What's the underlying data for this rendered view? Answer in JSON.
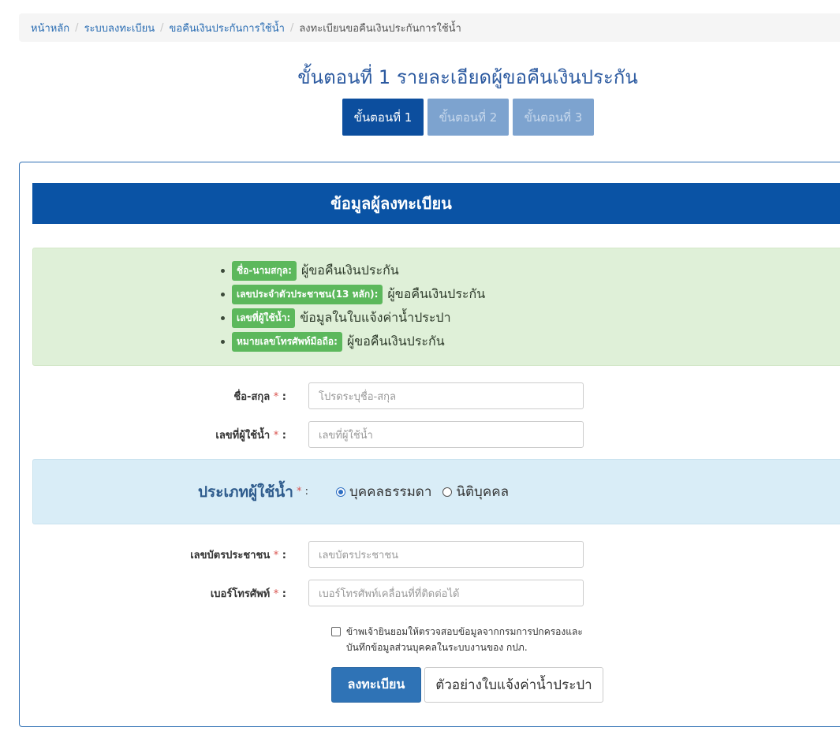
{
  "breadcrumb": {
    "items": [
      "หน้าหลัก",
      "ระบบลงทะเบียน",
      "ขอคืนเงินประกันการใช้น้ำ"
    ],
    "active": "ลงทะเบียนขอคืนเงินประกันการใช้น้ำ",
    "separator": "/"
  },
  "step_title": "ขั้นตอนที่ 1 รายละเอียดผู้ขอคืนเงินประกัน",
  "steps": [
    "ขั้นตอนที่ 1",
    "ขั้นตอนที่ 2",
    "ขั้นตอนที่ 3"
  ],
  "card": {
    "header": "ข้อมูลผู้ลงทะเบียน",
    "info": [
      {
        "badge": "ชื่อ-นามสกุล:",
        "text": "ผู้ขอคืนเงินประกัน"
      },
      {
        "badge": "เลขประจำตัวประชาชน(13 หลัก):",
        "text": "ผู้ขอคืนเงินประกัน"
      },
      {
        "badge": "เลขที่ผู้ใช้น้ำ:",
        "text": "ข้อมูลในใบแจ้งค่าน้ำประปา"
      },
      {
        "badge": "หมายเลขโทรศัพท์มือถือ:",
        "text": "ผู้ขอคืนเงินประกัน"
      }
    ]
  },
  "form": {
    "required_mark": "*",
    "colon": ":",
    "name": {
      "label": "ชื่อ-สกุล",
      "placeholder": "โปรดระบุชื่อ-สกุล"
    },
    "user_no": {
      "label": "เลขที่ผู้ใช้น้ำ",
      "placeholder": "เลขที่ผู้ใช้น้ำ"
    },
    "user_type": {
      "label": "ประเภทผู้ใช้น้ำ",
      "options": [
        "บุคคลธรรมดา",
        "นิติบุคคล"
      ],
      "selected": "บุคคลธรรมดา"
    },
    "id_card": {
      "label": "เลขบัตรประชาชน",
      "placeholder": "เลขบัตรประชาชน"
    },
    "phone": {
      "label": "เบอร์โทรศัพท์",
      "placeholder": "เบอร์โทรศัพท์เคลื่อนที่ที่ติดต่อได้"
    },
    "consent_line1": "ข้าพเจ้ายินยอมให้ตรวจสอบข้อมูลจากกรมการปกครองและ",
    "consent_line2": "บันทึกข้อมูลส่วนบุคคลในระบบงานของ กปภ.",
    "register_button": "ลงทะเบียน",
    "sample_button": "ตัวอย่างใบแจ้งค่าน้ำประปา"
  }
}
